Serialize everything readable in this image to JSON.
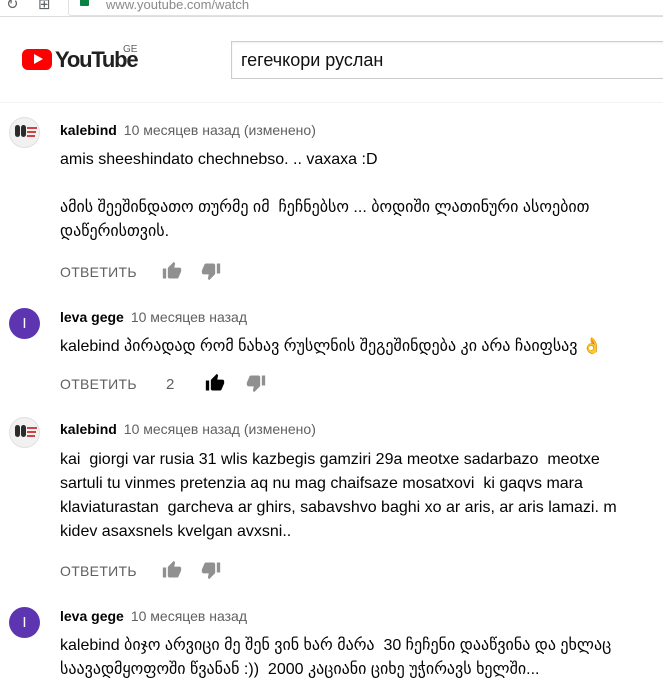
{
  "browser": {
    "url": "www.youtube.com/watch"
  },
  "header": {
    "logo_text": "YouTube",
    "country_code": "GE",
    "search_value": "гегечкори руслан"
  },
  "comments": [
    {
      "author": "kalebind",
      "time": "10 месяцев назад (изменено)",
      "avatar": "image",
      "text_lines": [
        "amis sheeshindato chechnebso. .. vaxaxa :D",
        "",
        "ამის შეეშინდათო თურმე იმ  ჩეჩნებსო ... ბოდიში ლათინური ასოებით",
        "დაწერისთვის."
      ],
      "reply_label": "ОТВЕТИТЬ",
      "likes": ""
    },
    {
      "author": "leva gege",
      "time": "10 месяцев назад",
      "avatar": "I",
      "text_lines": [
        "kalebind პირადად რომ ნახავ რუსლნის შეგეშინდება კი არა ჩაიფსავ 👌"
      ],
      "reply_label": "ОТВЕТИТЬ",
      "likes": "2"
    },
    {
      "author": "kalebind",
      "time": "10 месяцев назад (изменено)",
      "avatar": "image",
      "text_lines": [
        "kai  giorgi var rusia 31 wlis kazbegis gamziri 29a meotxe sadarbazo  meotxe",
        "sartuli tu vinmes pretenzia aq nu mag chaifsaze mosatxovi  ki gaqvs mara",
        "klaviaturastan  garcheva ar ghirs, sabavshvo baghi xo ar aris, ar aris lamazi. m",
        "kidev asaxsnels kvelgan avxsni.."
      ],
      "reply_label": "ОТВЕТИТЬ",
      "likes": ""
    },
    {
      "author": "leva gege",
      "time": "10 месяцев назад",
      "avatar": "I",
      "text_lines": [
        "kalebind ბიჯო არვიცი მე შენ ვინ ხარ მარა  30 ჩეჩენი დააწვინა და ეხლაც",
        "საავადმყოფოში წვანან :))  2000 კაციანი ციხე უჭირავს ხელში..."
      ],
      "reply_label": "ОТВЕТИТЬ",
      "likes": ""
    }
  ]
}
